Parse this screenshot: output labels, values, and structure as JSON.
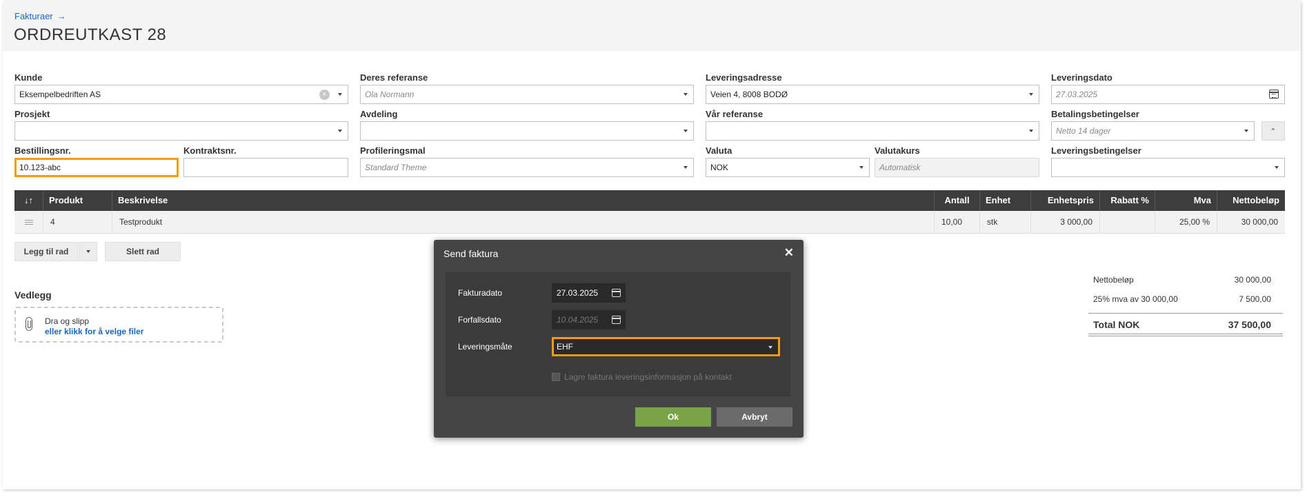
{
  "header": {
    "breadcrumb": "Fakturaer",
    "breadcrumb_arrow": "→",
    "title": "ORDREUTKAST 28"
  },
  "form": {
    "kunde": {
      "label": "Kunde",
      "value": "Eksempelbedriften AS"
    },
    "deres_referanse": {
      "label": "Deres referanse",
      "placeholder": "Ola Normann"
    },
    "leveringsadresse": {
      "label": "Leveringsadresse",
      "value": "Veien 4, 8008 BODØ"
    },
    "leveringsdato": {
      "label": "Leveringsdato",
      "placeholder": "27.03.2025"
    },
    "prosjekt": {
      "label": "Prosjekt",
      "value": ""
    },
    "avdeling": {
      "label": "Avdeling",
      "value": ""
    },
    "var_referanse": {
      "label": "Vår referanse",
      "value": ""
    },
    "betalingsbetingelser": {
      "label": "Betalingsbetingelser",
      "placeholder": "Netto 14 dager"
    },
    "bestillingsnr": {
      "label": "Bestillingsnr.",
      "value": "10.123-abc"
    },
    "kontraktsnr": {
      "label": "Kontraktsnr.",
      "value": ""
    },
    "profileringsmal": {
      "label": "Profileringsmal",
      "placeholder": "Standard Theme"
    },
    "valuta": {
      "label": "Valuta",
      "value": "NOK"
    },
    "valutakurs": {
      "label": "Valutakurs",
      "placeholder": "Automatisk"
    },
    "leveringsbetingelser": {
      "label": "Leveringsbetingelser",
      "value": ""
    }
  },
  "table": {
    "columns": {
      "sort": "↓↑",
      "produkt": "Produkt",
      "beskrivelse": "Beskrivelse",
      "antall": "Antall",
      "enhet": "Enhet",
      "enhetspris": "Enhetspris",
      "rabatt": "Rabatt %",
      "mva": "Mva",
      "netto": "Nettobeløp"
    },
    "rows": [
      {
        "produkt": "4",
        "beskrivelse": "Testprodukt",
        "antall": "10,00",
        "enhet": "stk",
        "enhetspris": "3 000,00",
        "rabatt": "",
        "mva": "25,00 %",
        "netto": "30 000,00"
      }
    ]
  },
  "row_actions": {
    "add": "Legg til rad",
    "delete": "Slett rad"
  },
  "attachments": {
    "title": "Vedlegg",
    "drop_text": "Dra og slipp",
    "pick_text": "eller klikk for å velge filer"
  },
  "summary": {
    "netto_label": "Nettobeløp",
    "netto_value": "30 000,00",
    "mva_label": "25% mva av 30 000,00",
    "mva_value": "7 500,00",
    "total_label": "Total NOK",
    "total_value": "37 500,00"
  },
  "modal": {
    "title": "Send faktura",
    "close": "✕",
    "fakturadato": {
      "label": "Fakturadato",
      "value": "27.03.2025"
    },
    "forfallsdato": {
      "label": "Forfallsdato",
      "value": "10.04.2025"
    },
    "leveringsmate": {
      "label": "Leveringsmåte",
      "value": "EHF"
    },
    "lagre_label": "Lagre faktura leveringsinformasjon på kontakt",
    "ok": "Ok",
    "cancel": "Avbryt"
  },
  "colors": {
    "accent": "#f39c12",
    "ok_green": "#79a347",
    "link": "#1a66c2",
    "table_head": "#3d3d3d"
  }
}
